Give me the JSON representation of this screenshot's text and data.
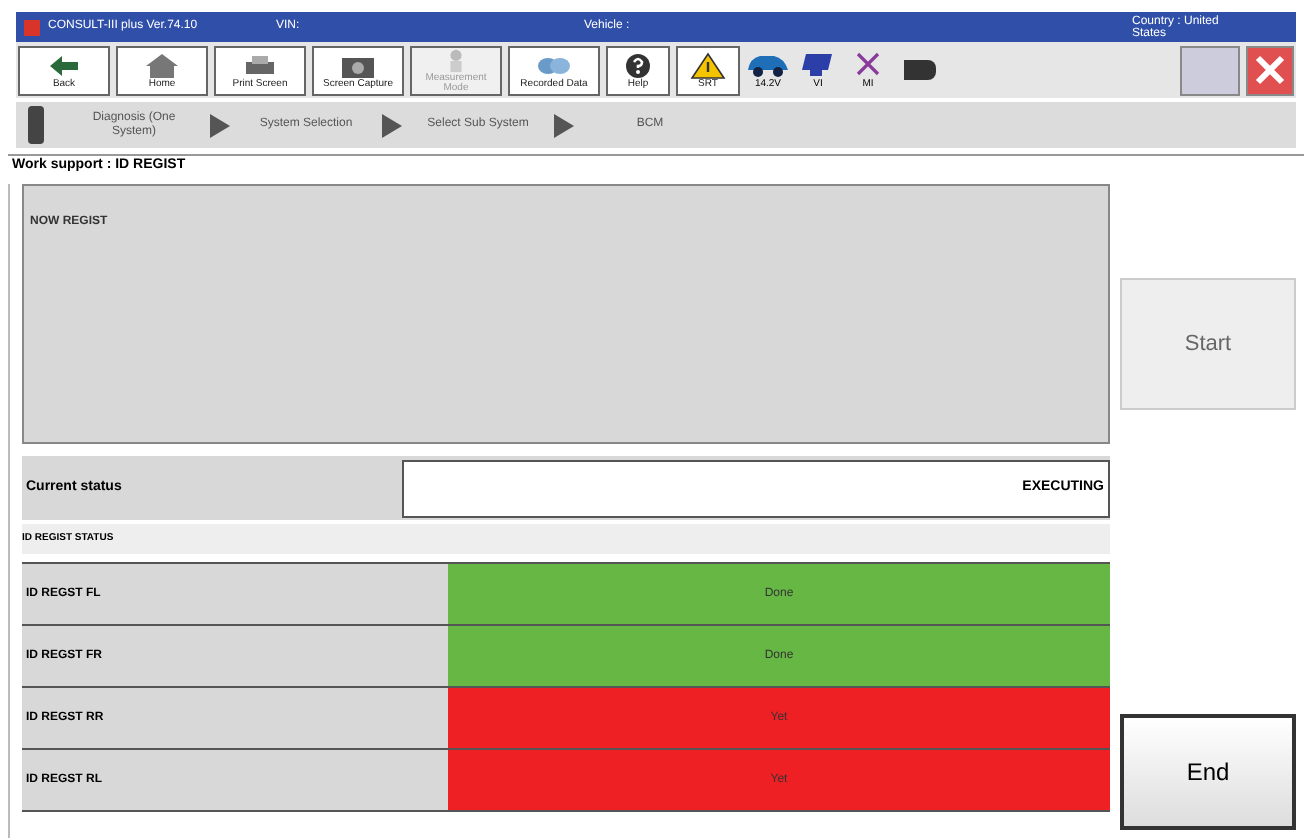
{
  "title_bar": {
    "app": "CONSULT-III plus  Ver.74.10",
    "vin": "VIN:",
    "vehicle": "Vehicle :",
    "country": "Country : United States"
  },
  "toolbar": [
    {
      "kind": "back",
      "label": "Back",
      "disabled": false
    },
    {
      "kind": "home",
      "label": "Home",
      "disabled": false
    },
    {
      "kind": "print",
      "label": "Print Screen",
      "disabled": false
    },
    {
      "kind": "camera",
      "label": "Screen Capture",
      "disabled": false
    },
    {
      "kind": "measure",
      "label": "Measurement Mode",
      "disabled": true
    },
    {
      "kind": "recorded",
      "label": "Recorded Data",
      "disabled": false
    },
    {
      "kind": "help",
      "label": "Help",
      "disabled": false
    },
    {
      "kind": "warning",
      "label": "SRT",
      "disabled": false
    }
  ],
  "indicators": [
    {
      "kind": "car",
      "label": "14.2V"
    },
    {
      "kind": "vi",
      "label": "VI"
    },
    {
      "kind": "mi",
      "label": "MI"
    }
  ],
  "breadcrumb": [
    "Diagnosis (One System)",
    "System Selection",
    "Select Sub System",
    "BCM"
  ],
  "work_support": "Work support : ID REGIST",
  "message_panel": {
    "title": "NOW REGIST"
  },
  "start_button": "Start",
  "current_status": {
    "label": "Current status",
    "value": "EXECUTING"
  },
  "status_section": "ID REGIST STATUS",
  "rows": [
    {
      "name": "ID REGST FL",
      "status": "Done",
      "color": "#66b744"
    },
    {
      "name": "ID REGST FR",
      "status": "Done",
      "color": "#66b744"
    },
    {
      "name": "ID REGST RR",
      "status": "Yet",
      "color": "#ee2024"
    },
    {
      "name": "ID REGST RL",
      "status": "Yet",
      "color": "#ee2024"
    }
  ],
  "end_button": "End"
}
